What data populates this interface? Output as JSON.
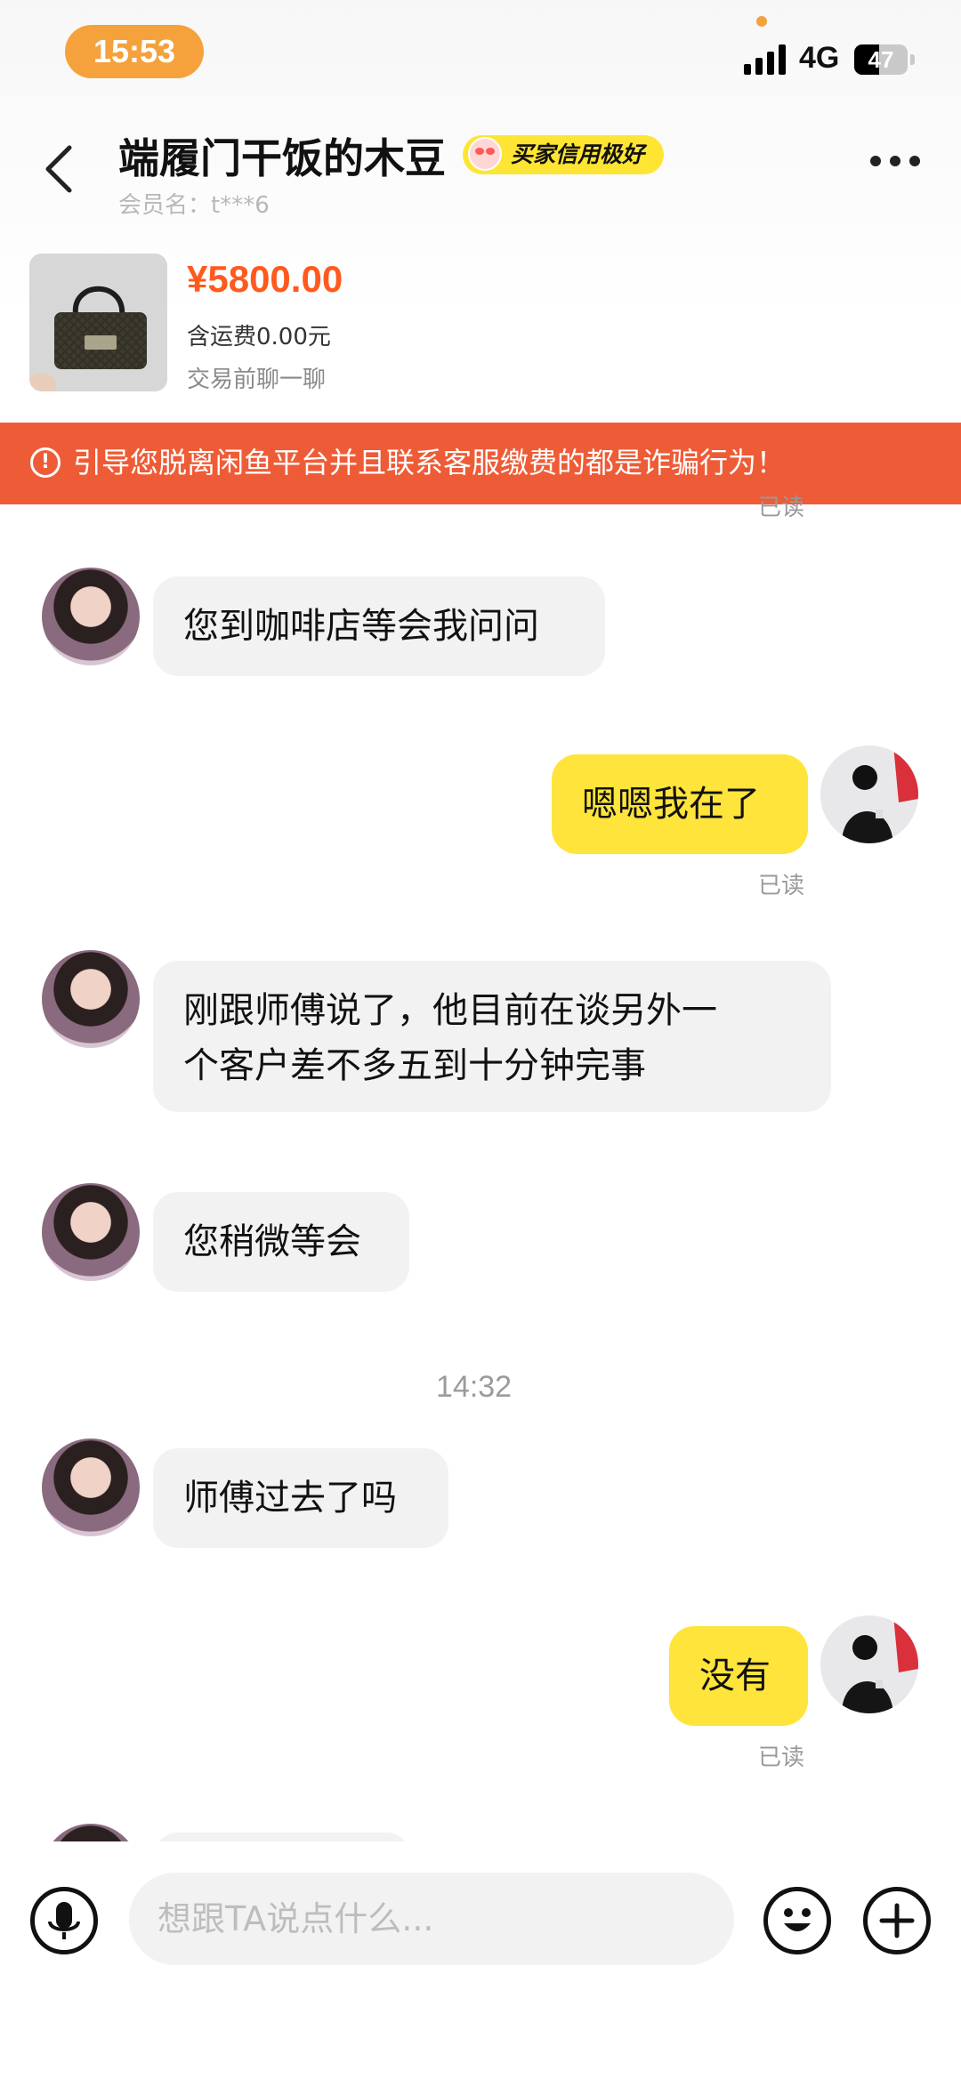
{
  "status_bar": {
    "time": "15:53",
    "network": "4G",
    "battery": "47",
    "battery_level": 0.47
  },
  "header": {
    "nickname": "端履门干饭的木豆",
    "credit_badge": "买家信用极好",
    "member_name": "会员名：t***6"
  },
  "product": {
    "price": "¥5800.00",
    "shipping": "含运费0.00元",
    "prompt": "交易前聊一聊"
  },
  "warning_banner": {
    "text": "引导您脱离闲鱼平台并且联系客服缴费的都是诈骗行为！",
    "icon": "alert-circle-icon"
  },
  "partial_top_read": "已读",
  "messages": [
    {
      "side": "in",
      "text": "您到咖啡店等会我问问"
    },
    {
      "side": "out",
      "text": "嗯嗯我在了",
      "status": "已读"
    },
    {
      "side": "in",
      "text_lines": [
        "刚跟师傅说了，他目前在谈另外一",
        "个客户差不多五到十分钟完事"
      ]
    },
    {
      "side": "in",
      "text": "您稍微等会"
    },
    {
      "type": "timestamp",
      "text": "14:32"
    },
    {
      "side": "in",
      "text": "师傅过去了吗"
    },
    {
      "side": "out",
      "text": "没有",
      "status": "已读"
    }
  ],
  "input_bar": {
    "placeholder": "想跟TA说点什么...",
    "icons": [
      "microphone-icon",
      "emoji-icon",
      "plus-icon"
    ]
  },
  "colors": {
    "accent_orange": "#ee5c37",
    "price": "#ff5a1e",
    "out_bubble": "#ffe43b",
    "in_bubble": "#f2f2f2",
    "time_pill": "#f5a23c"
  }
}
